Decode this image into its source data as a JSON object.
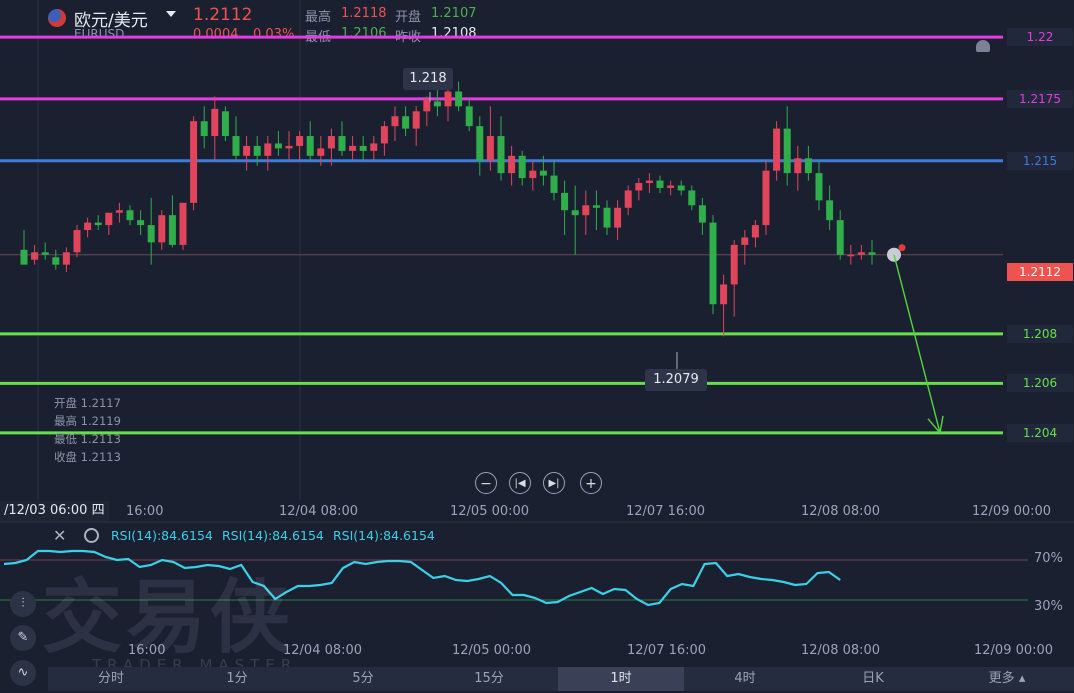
{
  "header": {
    "title": "欧元/美元",
    "symbol": "EURUSD",
    "price": "1.2112",
    "change": "0.0004",
    "change_pct": "0.03%",
    "high_label": "最高",
    "high_value": "1.2118",
    "open_label": "开盘",
    "open_value": "1.2107",
    "low_label": "最低",
    "low_value": "1.2106",
    "prev_close_label": "昨收",
    "prev_close_value": "1.2108"
  },
  "levels": [
    {
      "label": "1.22",
      "color": "#e53be0"
    },
    {
      "label": "1.2175",
      "color": "#e53be0"
    },
    {
      "label": "1.215",
      "color": "#3d7bdc"
    },
    {
      "label": "1.208",
      "color": "#66e04a"
    },
    {
      "label": "1.206",
      "color": "#66e04a"
    },
    {
      "label": "1.204",
      "color": "#66e04a"
    }
  ],
  "current_price_label": "1.2112",
  "annotations": {
    "high_marker": "1.218",
    "low_marker": "1.2079"
  },
  "ohlc_panel": {
    "open": "开盘 1.2117",
    "high": "最高 1.2119",
    "low": "最低 1.2113",
    "close": "收盘 1.2113"
  },
  "x_axis": {
    "cursor_label": "/12/03 06:00 四",
    "ticks": [
      "16:00",
      "12/04 08:00",
      "12/05 00:00",
      "12/07 16:00",
      "12/08 08:00",
      "12/09 00:00"
    ]
  },
  "rsi": {
    "labels": [
      "RSI(14):84.6154",
      "RSI(14):84.6154",
      "RSI(14):84.6154"
    ],
    "level_high": "70%",
    "level_low": "30%",
    "values": [
      66,
      67,
      70,
      79,
      79,
      78,
      79,
      79,
      78,
      73,
      70,
      71,
      63,
      65,
      70,
      68,
      62,
      63,
      65,
      64,
      61,
      65,
      48,
      44,
      31,
      38,
      44,
      44,
      45,
      47,
      62,
      68,
      66,
      68,
      69,
      69,
      68,
      60,
      52,
      54,
      50,
      49,
      51,
      54,
      47,
      35,
      35,
      32,
      27,
      28,
      34,
      38,
      42,
      36,
      41,
      40,
      31,
      25,
      27,
      41,
      46,
      44,
      66,
      67,
      54,
      56,
      53,
      51,
      50,
      48,
      45,
      46,
      57,
      58,
      50
    ],
    "x_ticks": [
      "16:00",
      "12/04 08:00",
      "12/05 00:00",
      "12/07 16:00",
      "12/08 08:00",
      "12/09 00:00"
    ]
  },
  "watermark": {
    "main": "交易侠",
    "sub": "TRADER MASTER"
  },
  "timeframes": [
    "分时",
    "1分",
    "5分",
    "15分",
    "1时",
    "4时",
    "日K",
    "更多"
  ],
  "active_timeframe": "1时",
  "chart_data": {
    "type": "candlestick",
    "ylim": [
      1.2027,
      1.2215
    ],
    "candles": [
      [
        1.2114,
        1.2122,
        1.211,
        1.2108
      ],
      [
        1.211,
        1.2116,
        1.2108,
        1.2113
      ],
      [
        1.2113,
        1.2117,
        1.211,
        1.2112
      ],
      [
        1.2111,
        1.2114,
        1.2106,
        1.2108
      ],
      [
        1.2108,
        1.2115,
        1.2105,
        1.2113
      ],
      [
        1.2113,
        1.2124,
        1.2111,
        1.2122
      ],
      [
        1.2122,
        1.2127,
        1.2119,
        1.2125
      ],
      [
        1.2125,
        1.2128,
        1.2122,
        1.2124
      ],
      [
        1.2124,
        1.2128,
        1.212,
        1.2129
      ],
      [
        1.2129,
        1.2133,
        1.2125,
        1.213
      ],
      [
        1.213,
        1.2132,
        1.2124,
        1.2126
      ],
      [
        1.2126,
        1.213,
        1.212,
        1.2124
      ],
      [
        1.2124,
        1.2135,
        1.2108,
        1.2117
      ],
      [
        1.2117,
        1.213,
        1.2114,
        1.2128
      ],
      [
        1.2128,
        1.2136,
        1.2115,
        1.2116
      ],
      [
        1.2116,
        1.2133,
        1.2114,
        1.2133
      ],
      [
        1.2133,
        1.2168,
        1.213,
        1.2166
      ],
      [
        1.2166,
        1.2172,
        1.2155,
        1.216
      ],
      [
        1.216,
        1.2176,
        1.215,
        1.2171
      ],
      [
        1.217,
        1.2172,
        1.2158,
        1.216
      ],
      [
        1.216,
        1.2168,
        1.215,
        1.2152
      ],
      [
        1.2152,
        1.216,
        1.2146,
        1.2156
      ],
      [
        1.2156,
        1.216,
        1.2148,
        1.2152
      ],
      [
        1.2152,
        1.216,
        1.2146,
        1.2157
      ],
      [
        1.2157,
        1.2162,
        1.2152,
        1.2155
      ],
      [
        1.2155,
        1.2162,
        1.215,
        1.2156
      ],
      [
        1.2156,
        1.2162,
        1.215,
        1.216
      ],
      [
        1.216,
        1.2166,
        1.215,
        1.2152
      ],
      [
        1.2152,
        1.216,
        1.2148,
        1.2155
      ],
      [
        1.2155,
        1.2163,
        1.2148,
        1.216
      ],
      [
        1.216,
        1.2166,
        1.2152,
        1.2154
      ],
      [
        1.2154,
        1.216,
        1.215,
        1.2156
      ],
      [
        1.2156,
        1.216,
        1.215,
        1.2154
      ],
      [
        1.2154,
        1.216,
        1.215,
        1.2157
      ],
      [
        1.2157,
        1.2166,
        1.2152,
        1.2164
      ],
      [
        1.2164,
        1.2172,
        1.2158,
        1.2168
      ],
      [
        1.2168,
        1.2172,
        1.216,
        1.2163
      ],
      [
        1.2163,
        1.2172,
        1.2156,
        1.217
      ],
      [
        1.217,
        1.2176,
        1.2164,
        1.2175
      ],
      [
        1.2174,
        1.2182,
        1.2168,
        1.2172
      ],
      [
        1.2172,
        1.218,
        1.2166,
        1.2178
      ],
      [
        1.2178,
        1.2182,
        1.217,
        1.2172
      ],
      [
        1.2172,
        1.2175,
        1.2162,
        1.2164
      ],
      [
        1.2164,
        1.2168,
        1.2144,
        1.215
      ],
      [
        1.215,
        1.2172,
        1.2146,
        1.216
      ],
      [
        1.216,
        1.2168,
        1.2142,
        1.2145
      ],
      [
        1.2145,
        1.2156,
        1.214,
        1.2152
      ],
      [
        1.2152,
        1.2154,
        1.214,
        1.2143
      ],
      [
        1.2143,
        1.215,
        1.2138,
        1.2146
      ],
      [
        1.2146,
        1.2152,
        1.214,
        1.2144
      ],
      [
        1.2144,
        1.215,
        1.2134,
        1.2137
      ],
      [
        1.2137,
        1.2142,
        1.212,
        1.213
      ],
      [
        1.213,
        1.214,
        1.2112,
        1.2128
      ],
      [
        1.2128,
        1.2138,
        1.212,
        1.2132
      ],
      [
        1.2132,
        1.2138,
        1.2122,
        1.2131
      ],
      [
        1.2131,
        1.2134,
        1.212,
        1.2123
      ],
      [
        1.2123,
        1.2134,
        1.2118,
        1.2131
      ],
      [
        1.2131,
        1.214,
        1.2128,
        1.2138
      ],
      [
        1.2138,
        1.2143,
        1.2134,
        1.2141
      ],
      [
        1.2141,
        1.2145,
        1.2137,
        1.2142
      ],
      [
        1.2142,
        1.2144,
        1.2137,
        1.2139
      ],
      [
        1.2139,
        1.2142,
        1.2136,
        1.214
      ],
      [
        1.214,
        1.2142,
        1.2136,
        1.2138
      ],
      [
        1.2138,
        1.214,
        1.213,
        1.2132
      ],
      [
        1.2132,
        1.2135,
        1.212,
        1.2125
      ],
      [
        1.2125,
        1.2128,
        1.2088,
        1.2092
      ],
      [
        1.2092,
        1.2104,
        1.2079,
        1.21
      ],
      [
        1.21,
        1.2118,
        1.2087,
        1.2116
      ],
      [
        1.2116,
        1.2122,
        1.2108,
        1.2119
      ],
      [
        1.2119,
        1.2126,
        1.2115,
        1.2124
      ],
      [
        1.2124,
        1.215,
        1.212,
        1.2146
      ],
      [
        1.2146,
        1.2166,
        1.2142,
        1.2163
      ],
      [
        1.2163,
        1.2172,
        1.214,
        1.2145
      ],
      [
        1.2145,
        1.2156,
        1.2138,
        1.2151
      ],
      [
        1.2151,
        1.2156,
        1.2142,
        1.2145
      ],
      [
        1.2145,
        1.215,
        1.213,
        1.2134
      ],
      [
        1.2134,
        1.214,
        1.2122,
        1.2126
      ],
      [
        1.2126,
        1.213,
        1.211,
        1.2112
      ],
      [
        1.2112,
        1.2116,
        1.2108,
        1.2112
      ],
      [
        1.2112,
        1.2116,
        1.211,
        1.2113
      ],
      [
        1.2113,
        1.2118,
        1.2108,
        1.2112
      ]
    ]
  }
}
